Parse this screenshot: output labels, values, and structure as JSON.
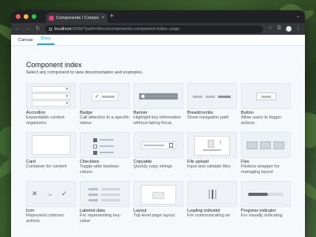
{
  "browser": {
    "tab_title": "Components / Component ind",
    "tab_close": "×",
    "new_tab": "+",
    "tab_menu": "⌄",
    "url_host": "localhost",
    "url_path": ":6006/?path=/docs/components-component-index--page",
    "nav_back": "←",
    "nav_forward": "→",
    "nav_reload": "↻",
    "star": "☆",
    "extensions": "⧉",
    "menu": "⋮"
  },
  "app_tabs": [
    {
      "label": "Canvas",
      "active": false
    },
    {
      "label": "Docs",
      "active": true
    }
  ],
  "page": {
    "title": "Component index",
    "subtitle": "Select any component to view documentation and examples."
  },
  "components": [
    {
      "name": "Accordion",
      "desc": "Expandable content organizers"
    },
    {
      "name": "Badge",
      "desc": "Call attention to a specific status"
    },
    {
      "name": "Banner",
      "desc": "Highlight key information without taking focus"
    },
    {
      "name": "Breadcrumbs",
      "desc": "Show navigation path"
    },
    {
      "name": "Button",
      "desc": "Allow users to trigger actions"
    },
    {
      "name": "Card",
      "desc": "Container for content"
    },
    {
      "name": "Checkbox",
      "desc": "Toggle-able boolean values"
    },
    {
      "name": "Copyable",
      "desc": "Quickly copy strings"
    },
    {
      "name": "File upload",
      "desc": "Input and validate files"
    },
    {
      "name": "Flex",
      "desc": "Flexbox wrapper for managing layout"
    },
    {
      "name": "Icon",
      "desc": "Represent common actions"
    },
    {
      "name": "Labeled data",
      "desc": "For representing key-value"
    },
    {
      "name": "Layout",
      "desc": "Top-level page layout"
    },
    {
      "name": "Loading indicator",
      "desc": "For communicating an"
    },
    {
      "name": "Progress indicator",
      "desc": "For visually indicating"
    }
  ],
  "thumb_glyphs": {
    "accordion_chevron": "▾",
    "badge_check": "✓",
    "upload_arrow": "↑",
    "icon_set": "✕ → ✓"
  },
  "progress_indicator_fraction": 0.55,
  "colors": {
    "accent": "#1ea7fd",
    "favicon": "#e83e6c"
  }
}
